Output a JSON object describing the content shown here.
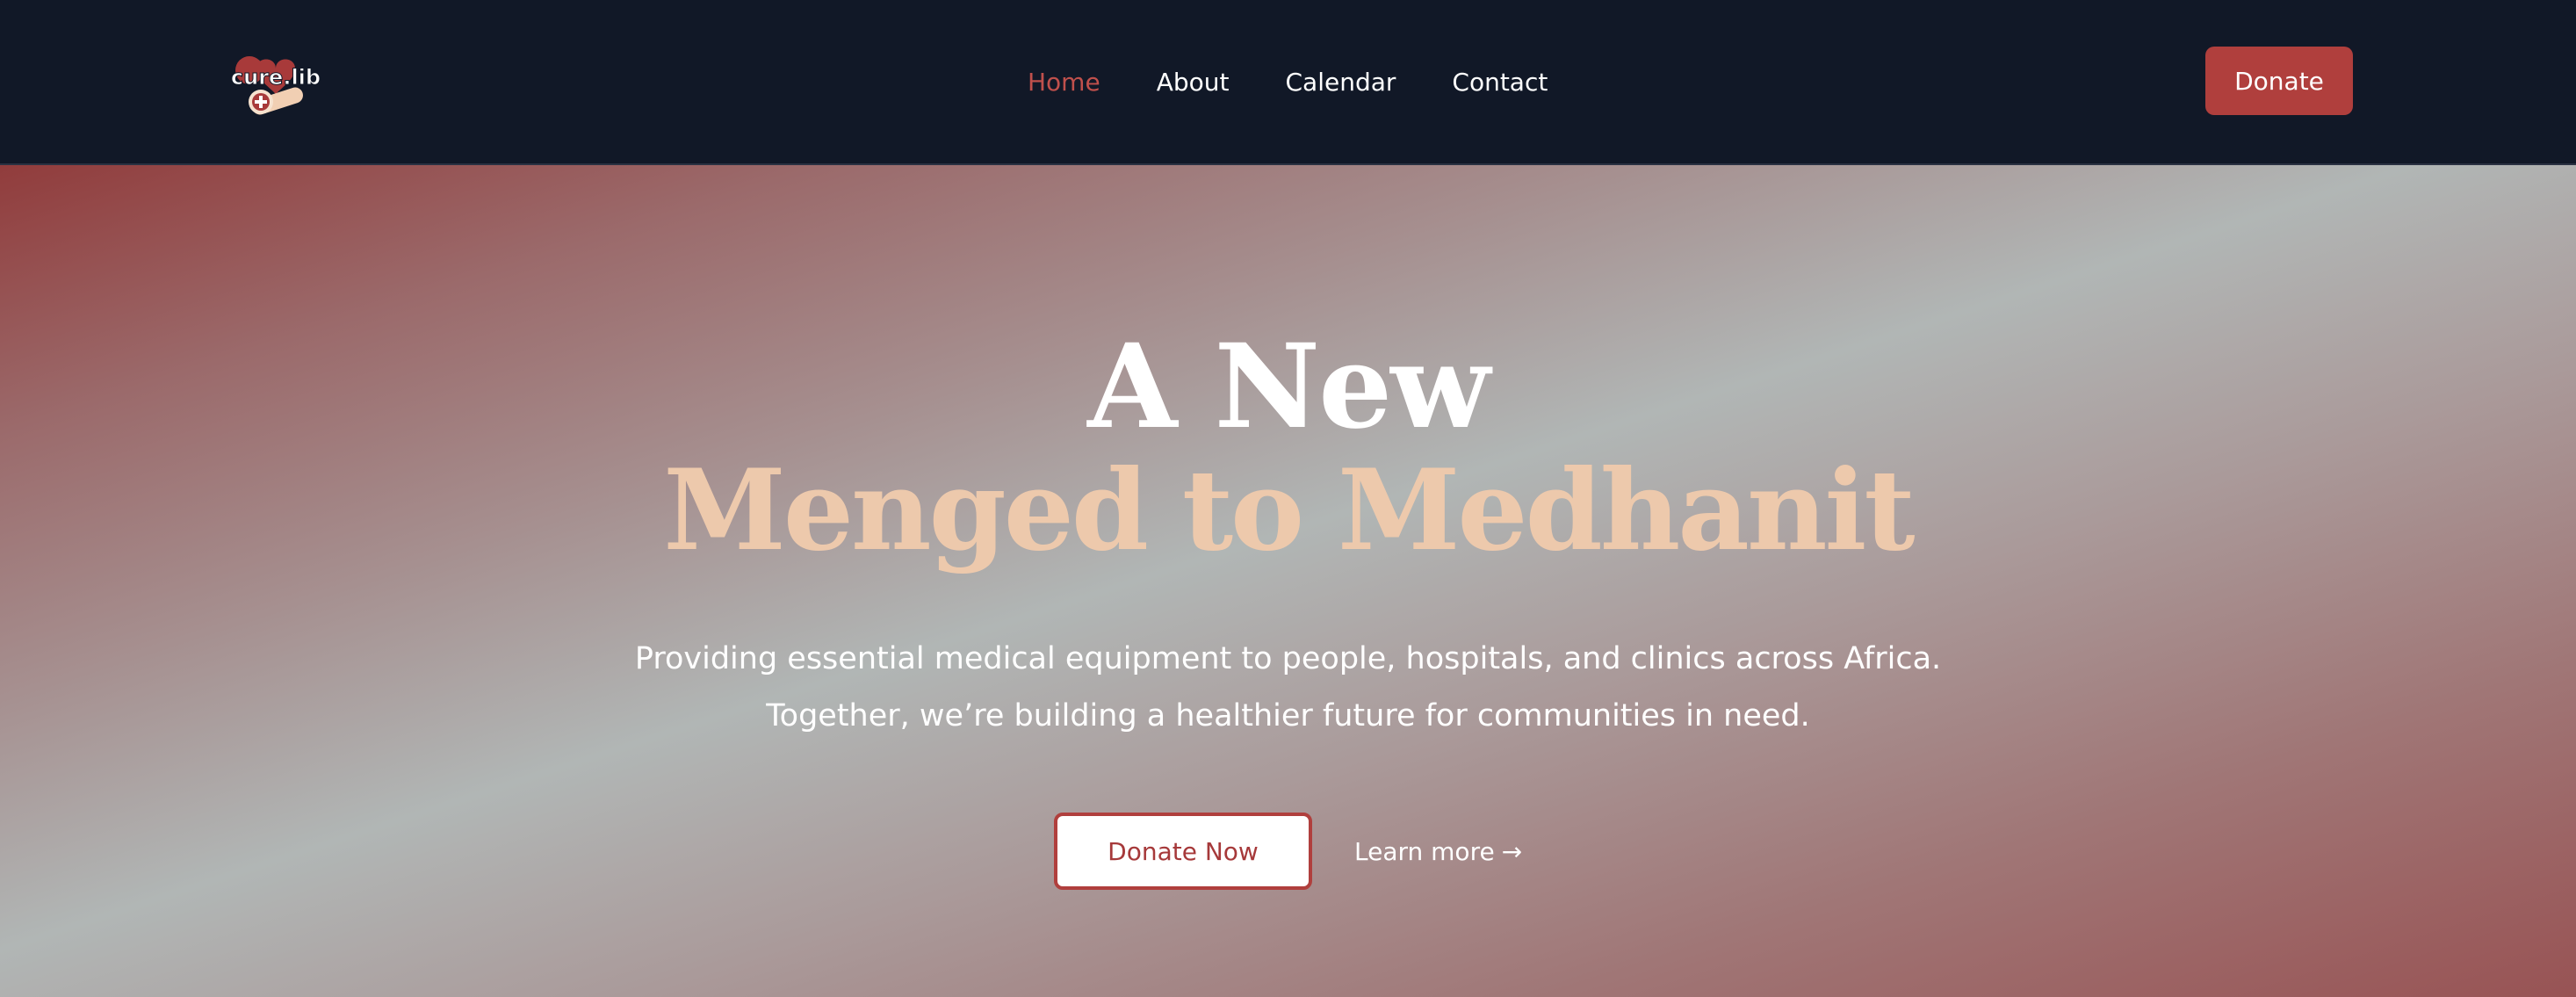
{
  "header": {
    "logo_text": "cure.lib",
    "nav": [
      {
        "label": "Home",
        "active": true
      },
      {
        "label": "About",
        "active": false
      },
      {
        "label": "Calendar",
        "active": false
      },
      {
        "label": "Contact",
        "active": false
      }
    ],
    "donate_label": "Donate"
  },
  "hero": {
    "title_line1": "A New",
    "title_line2": "Menged to Medhanit",
    "subtitle_line1": "Providing essential medical equipment to people, hospitals, and clinics across Africa.",
    "subtitle_line2": "Together, we’re building a healthier future for communities in need.",
    "primary_cta": "Donate Now",
    "secondary_cta": "Learn more",
    "secondary_cta_icon": "arrow-right-icon"
  },
  "colors": {
    "header_bg": "#111827",
    "accent": "#b03f3d",
    "active_nav": "#c0504c",
    "title_accent": "#edc9ac"
  }
}
